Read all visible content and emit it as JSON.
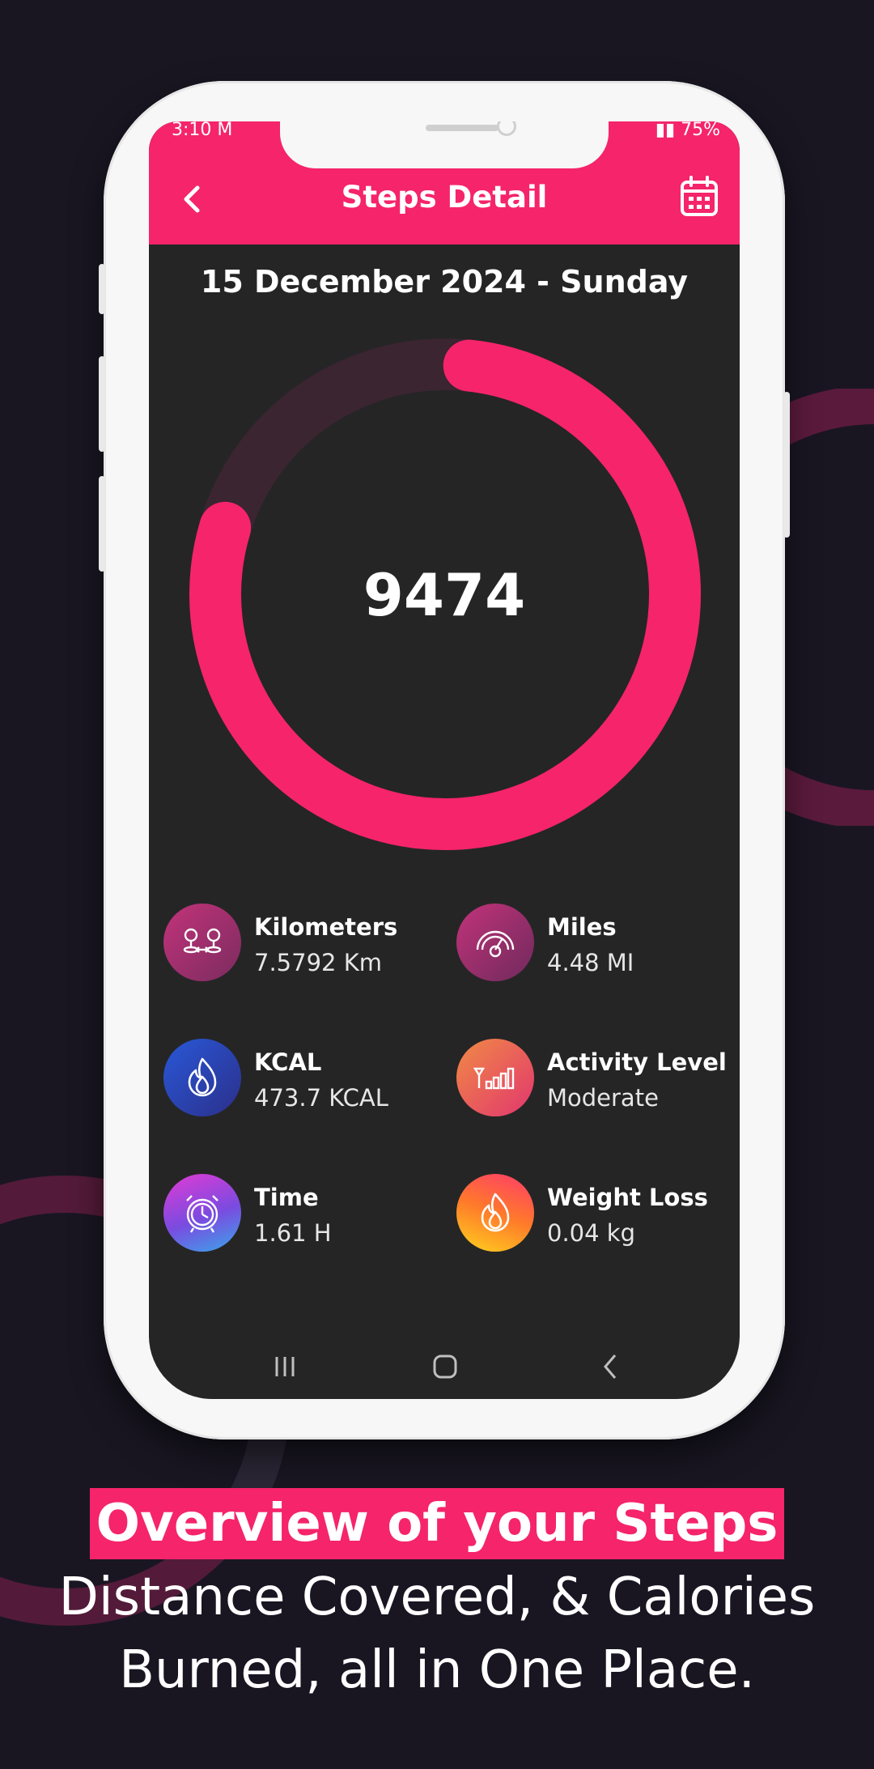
{
  "status_bar": {
    "time": "3:10 M",
    "battery": "75%"
  },
  "header": {
    "title": "Steps Detail",
    "back_icon": "chevron-left-icon",
    "calendar_icon": "calendar-icon"
  },
  "date": "15 December 2024 - Sunday",
  "steps": {
    "count": "9474",
    "ring_progress": 0.78
  },
  "stats": [
    {
      "label": "Kilometers",
      "value": "7.5792 Km",
      "icon": "distance-pins-icon"
    },
    {
      "label": "Miles",
      "value": "4.48 MI",
      "icon": "speedometer-icon"
    },
    {
      "label": "KCAL",
      "value": "473.7 KCAL",
      "icon": "flame-icon"
    },
    {
      "label": "Activity Level",
      "value": "Moderate",
      "icon": "signal-bars-icon"
    },
    {
      "label": "Time",
      "value": "1.61 H",
      "icon": "alarm-clock-icon"
    },
    {
      "label": "Weight Loss",
      "value": "0.04 kg",
      "icon": "fire-icon"
    }
  ],
  "caption": {
    "headline": "Overview of your Steps",
    "line1": "Distance Covered, & Calories",
    "line2": "Burned, all in One Place."
  },
  "colors": {
    "accent": "#f5246b",
    "background": "#191622",
    "screen": "#252525"
  }
}
